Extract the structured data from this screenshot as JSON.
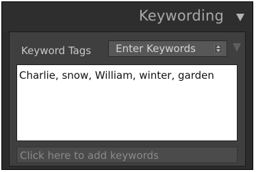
{
  "panel": {
    "title": "Keywording"
  },
  "keyword_tags": {
    "label": "Keyword Tags",
    "mode_value": "Enter Keywords"
  },
  "keywords_box": {
    "value": "Charlie, snow, William, winter, garden"
  },
  "add_keywords": {
    "placeholder": "Click here to add keywords"
  },
  "icons": {
    "panel_toggle": "triangle-down-icon",
    "stepper": "stepper-icon",
    "filter": "triangle-down-icon"
  }
}
